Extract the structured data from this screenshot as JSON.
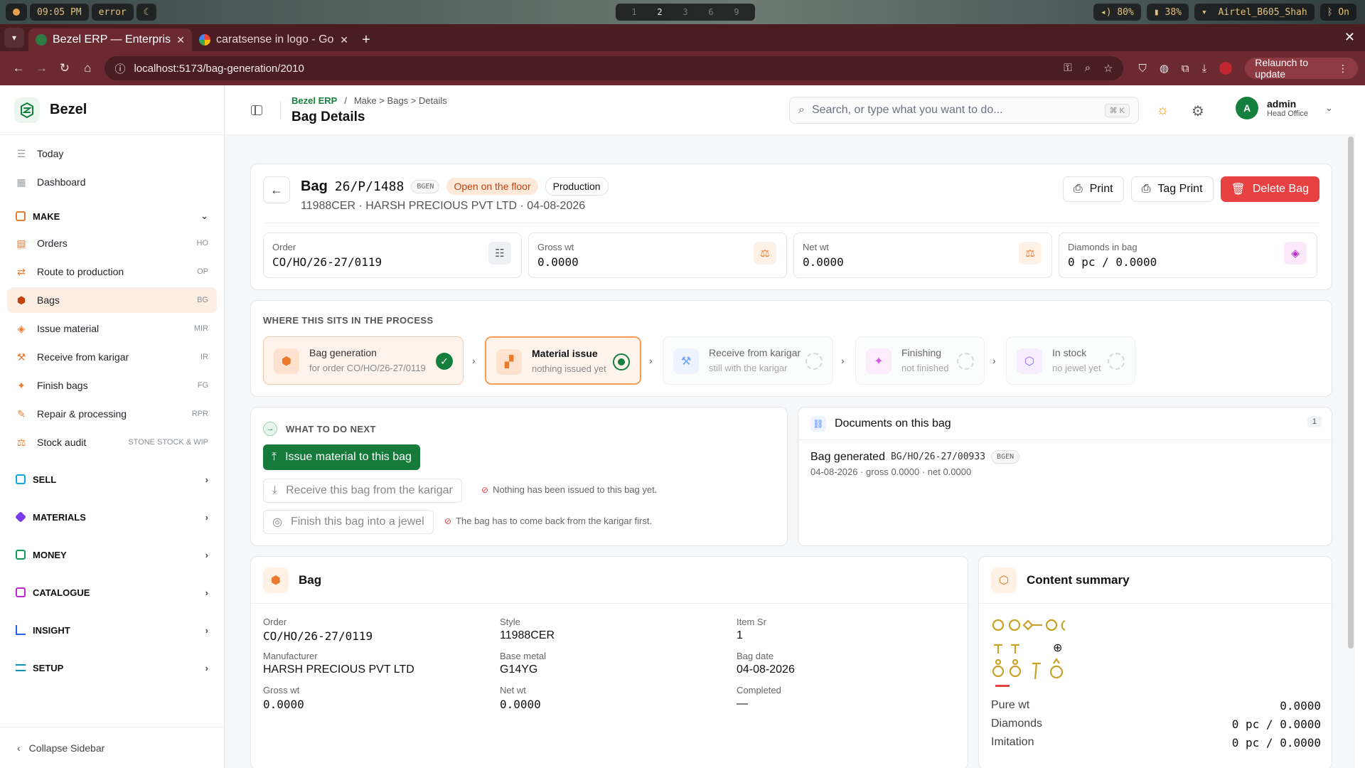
{
  "os": {
    "time": "09:05 PM",
    "status": "error",
    "workspaces": [
      "1",
      "2",
      "3",
      "6",
      "9"
    ],
    "active_workspace": "2",
    "volume": "80%",
    "battery": "38%",
    "wifi": "Airtel_B605_Shah",
    "bluetooth": "On"
  },
  "browser": {
    "tabs": [
      {
        "label": "Bezel ERP — Enterprise",
        "active": true
      },
      {
        "label": "caratsense in logo - Go",
        "active": false
      }
    ],
    "url": "localhost:5173/bag-generation/2010",
    "relaunch_label": "Relaunch to update"
  },
  "sidebar": {
    "brand": "Bezel",
    "items": [
      {
        "label": "Today",
        "code": ""
      },
      {
        "label": "Dashboard",
        "code": ""
      }
    ],
    "make_section": "MAKE",
    "make_items": [
      {
        "label": "Orders",
        "code": "HO"
      },
      {
        "label": "Route to production",
        "code": "OP"
      },
      {
        "label": "Bags",
        "code": "BG",
        "active": true
      },
      {
        "label": "Issue material",
        "code": "MIR"
      },
      {
        "label": "Receive from karigar",
        "code": "IR"
      },
      {
        "label": "Finish bags",
        "code": "FG"
      },
      {
        "label": "Repair & processing",
        "code": "RPR"
      },
      {
        "label": "Stock audit",
        "code": "STONE STOCK & WIP"
      }
    ],
    "sections": [
      "SELL",
      "MATERIALS",
      "MONEY",
      "CATALOGUE",
      "INSIGHT",
      "SETUP"
    ],
    "section_colors": [
      "#0ea5e9",
      "#7c3aed",
      "#0f9d58",
      "#c026d3",
      "#2563eb",
      "#0891b2"
    ],
    "collapse_label": "Collapse Sidebar"
  },
  "topbar": {
    "breadcrumb_root": "Bezel ERP",
    "breadcrumb_sep": "/",
    "breadcrumb_path": "Make > Bags > Details",
    "title": "Bag Details",
    "search_placeholder": "Search, or type what you want to do...",
    "search_kbd": "⌘ K",
    "user_initial": "A",
    "user_name": "admin",
    "user_branch": "Head Office"
  },
  "header": {
    "word": "Bag",
    "code": "26/P/1488",
    "tag": "BGEN",
    "status": "Open on the floor",
    "stage": "Production",
    "subtitle": "11988CER · HARSH PRECIOUS PVT LTD · 04-08-2026",
    "print_label": "Print",
    "tag_print_label": "Tag Print",
    "delete_label": "Delete Bag",
    "stats": [
      {
        "label": "Order",
        "value": "CO/HO/26-27/0119"
      },
      {
        "label": "Gross wt",
        "value": "0.0000"
      },
      {
        "label": "Net wt",
        "value": "0.0000"
      },
      {
        "label": "Diamonds in bag",
        "value": "0 pc / 0.0000"
      }
    ]
  },
  "process": {
    "label": "WHERE THIS SITS IN THE PROCESS",
    "steps": [
      {
        "title": "Bag generation",
        "sub": "for order CO/HO/26-27/0119",
        "state": "done"
      },
      {
        "title": "Material issue",
        "sub": "nothing issued yet",
        "state": "current"
      },
      {
        "title": "Receive from karigar",
        "sub": "still with the karigar",
        "state": "todo"
      },
      {
        "title": "Finishing",
        "sub": "not finished",
        "state": "todo"
      },
      {
        "title": "In stock",
        "sub": "no jewel yet",
        "state": "todo"
      }
    ]
  },
  "next": {
    "label": "WHAT TO DO NEXT",
    "primary": "Issue material to this bag",
    "receive": "Receive this bag from the karigar",
    "receive_hint": "Nothing has been issued to this bag yet.",
    "finish": "Finish this bag into a jewel",
    "finish_hint": "The bag has to come back from the karigar first."
  },
  "documents": {
    "title": "Documents on this bag",
    "count": "1",
    "items": [
      {
        "title": "Bag generated",
        "code": "BG/HO/26-27/00933",
        "tag": "BGEN",
        "meta": "04-08-2026 · gross 0.0000 · net 0.0000"
      }
    ]
  },
  "bag": {
    "title": "Bag",
    "fields": [
      {
        "label": "Order",
        "value": "CO/HO/26-27/0119"
      },
      {
        "label": "Style",
        "value": "11988CER"
      },
      {
        "label": "Item Sr",
        "value": "1"
      },
      {
        "label": "Manufacturer",
        "value": "HARSH PRECIOUS PVT LTD"
      },
      {
        "label": "Base metal",
        "value": "G14YG"
      },
      {
        "label": "Bag date",
        "value": "04-08-2026"
      },
      {
        "label": "Gross wt",
        "value": "0.0000"
      },
      {
        "label": "Net wt",
        "value": "0.0000"
      },
      {
        "label": "Completed",
        "value": "—"
      }
    ]
  },
  "summary": {
    "title": "Content summary",
    "rows": [
      {
        "label": "Pure wt",
        "value": "0.0000"
      },
      {
        "label": "Diamonds",
        "value": "0 pc / 0.0000"
      },
      {
        "label": "Imitation",
        "value": "0 pc / 0.0000"
      }
    ]
  }
}
